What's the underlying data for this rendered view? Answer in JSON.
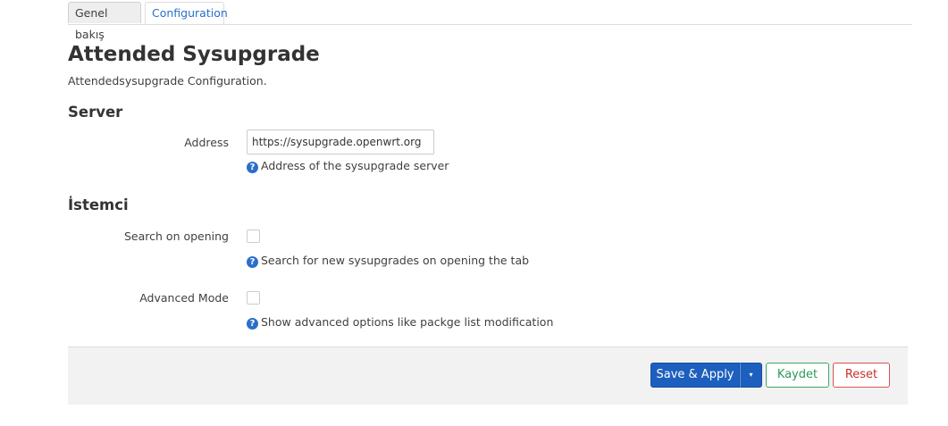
{
  "tabs": [
    {
      "label": "Genel bakış",
      "active": false
    },
    {
      "label": "Configuration",
      "active": true
    }
  ],
  "page": {
    "title": "Attended Sysupgrade",
    "description": "Attendedsysupgrade Configuration."
  },
  "server": {
    "title": "Server",
    "address": {
      "label": "Address",
      "value": "https://sysupgrade.openwrt.org",
      "help": "Address of the sysupgrade server"
    }
  },
  "client": {
    "title": "İstemci",
    "search_on_opening": {
      "label": "Search on opening",
      "checked": false,
      "help": "Search for new sysupgrades on opening the tab"
    },
    "advanced_mode": {
      "label": "Advanced Mode",
      "checked": false,
      "help": "Show advanced options like packge list modification"
    }
  },
  "help_icon_glyph": "?",
  "actions": {
    "save_apply": "Save & Apply",
    "dropdown_glyph": "▾",
    "save": "Kaydet",
    "reset": "Reset"
  },
  "colors": {
    "accent": "#2a6fc9",
    "primary_button": "#1d5fbf",
    "save_button": "#3aa86a",
    "reset_button": "#d9534f"
  },
  "icons": {
    "help": "question-circle-icon",
    "dropdown": "caret-down-icon"
  }
}
